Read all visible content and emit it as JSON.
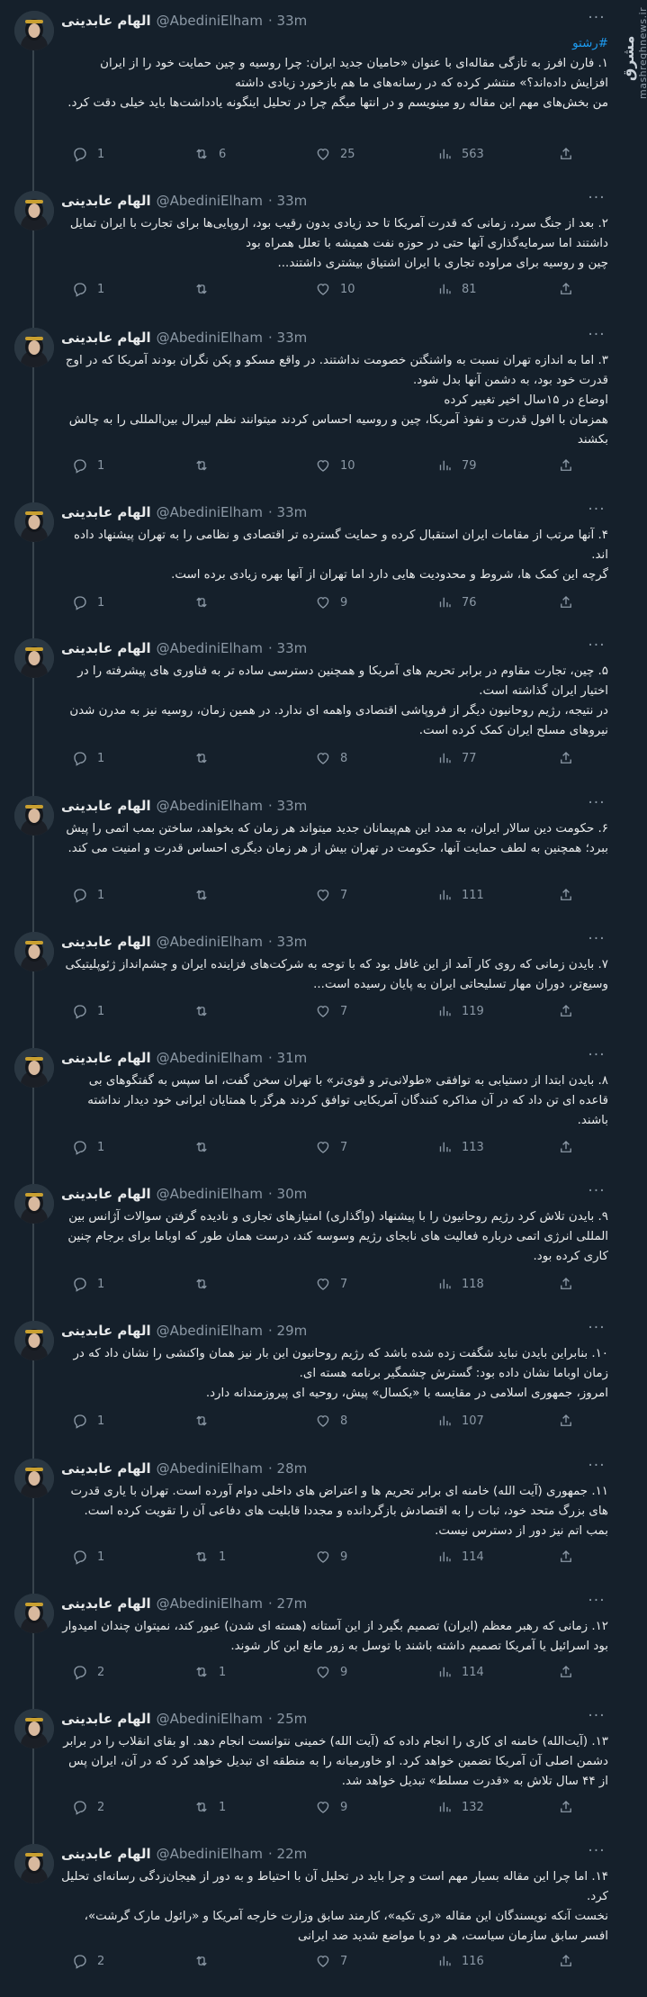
{
  "author": {
    "name": "الهام عابدینی",
    "handle": "@AbediniElham"
  },
  "brand": {
    "logo": "مشرق",
    "url": "mashreghnews.ir"
  },
  "icons": {
    "reply": "reply-icon",
    "retweet": "retweet-icon",
    "like": "heart-icon",
    "views": "views-icon",
    "share": "share-icon",
    "more": "more-icon"
  },
  "colors": {
    "background": "#15202b",
    "text": "#e7e9ea",
    "muted": "#8b98a5",
    "link": "#1d9bf0",
    "thread_line": "#38444d"
  },
  "tweets": [
    {
      "time": "· 33m",
      "hashtag": "#رشتو",
      "text": "۱. فارن افرز به تازگی مقاله‌ای با عنوان «حامیان جدید ایران: چرا روسیه و چین حمایت خود را از ایران افزایش داده‌اند؟» منتشر کرده که در رسانه‌های ما هم بازخورد زیادی داشته\nمن بخش‌های مهم این مقاله رو مینویسم و در انتها میگم چرا در تحلیل اینگونه یادداشت‌ها باید خیلی دقت کرد.",
      "reply": "1",
      "retweet": "6",
      "like": "25",
      "views": "563"
    },
    {
      "time": "· 33m",
      "hashtag": "",
      "text": "۲. بعد از جنگ سرد، زمانی که قدرت آمریکا تا حد زیادی بدون رقیب بود، اروپایی‌ها برای تجارت با ایران تمایل داشتند اما سرمایه‌گذاری آنها حتی در حوزه نفت همیشه با تعلل همراه بود\nچین و روسیه برای مراوده تجاری با ایران اشتیاق بیشتری داشتند...",
      "reply": "1",
      "retweet": "",
      "like": "10",
      "views": "81"
    },
    {
      "time": "· 33m",
      "hashtag": "",
      "text": "۳. اما به اندازه تهران نسبت به واشنگتن خصومت نداشتند. در واقع مسکو و پکن نگران بودند آمریکا که در اوج قدرت خود بود، به دشمن آنها بدل شود.\nاوضاع در ۱۵سال اخیر تغییر کرده\nهمزمان با افول قدرت و نفوذ آمریکا، چین و روسیه احساس کردند میتوانند نظم لیبرال بین‌المللی را به چالش بکشند",
      "reply": "1",
      "retweet": "",
      "like": "10",
      "views": "79"
    },
    {
      "time": "· 33m",
      "hashtag": "",
      "text": "۴. آنها مرتب از مقامات ایران استقبال کرده و حمایت گسترده تر اقتصادی و نظامی را به تهران پیشنهاد داده اند.\nگرچه این کمک ها، شروط و محدودیت هایی دارد اما تهران از آنها بهره زیادی برده است.",
      "reply": "1",
      "retweet": "",
      "like": "9",
      "views": "76"
    },
    {
      "time": "· 33m",
      "hashtag": "",
      "text": "۵. چین، تجارت مقاوم در برابر تحریم های آمریکا و همچنین دسترسی ساده تر به فناوری های پیشرفته را در اختیار ایران گذاشته است.\nدر نتیجه، رژیم روحانیون دیگر از فروپاشی اقتصادی واهمه ای ندارد. در همین زمان، روسیه نیز به مدرن شدن نیروهای مسلح ایران کمک کرده است.",
      "reply": "1",
      "retweet": "",
      "like": "8",
      "views": "77"
    },
    {
      "time": "· 33m",
      "hashtag": "",
      "text": "۶. حکومت دین سالار ایران، به مدد این هم‌پیمانان جدید میتواند هر زمان که بخواهد، ساختن بمب اتمی را پیش ببرد؛ همچنین به لطف حمایت آنها، حکومت در تهران بیش از هر زمان دیگری احساس قدرت و امنیت می کند.",
      "reply": "1",
      "retweet": "",
      "like": "7",
      "views": "111"
    },
    {
      "time": "· 33m",
      "hashtag": "",
      "text": "۷. بایدن زمانی که روی کار آمد از این غافل بود که با توجه به شرکت‌های فزاینده ایران و چشم‌انداز ژئوپلیتیکی وسیع‌تر، دوران مهار تسلیحاتی ایران به پایان رسیده است...",
      "reply": "1",
      "retweet": "",
      "like": "7",
      "views": "119"
    },
    {
      "time": "· 31m",
      "hashtag": "",
      "text": "۸. بایدن ابتدا از دستیابی به توافقی «طولانی‌تر و قوی‌تر» با تهران سخن گفت، اما سپس به گفتگوهای بی قاعده ای تن داد که در آن مذاکره کنندگان آمریکایی توافق کردند هرگز با همتایان ایرانی خود دیدار نداشته باشند.",
      "reply": "1",
      "retweet": "",
      "like": "7",
      "views": "113"
    },
    {
      "time": "· 30m",
      "hashtag": "",
      "text": "۹. بایدن تلاش کرد رژیم روحانیون را با پیشنهاد (واگذاری) امتیازهای تجاری و نادیده گرفتن سوالات آژانس بین المللی انرژی اتمی درباره فعالیت های نابجای رژیم وسوسه کند، درست همان طور که اوباما برای برجام چنین کاری کرده بود.",
      "reply": "1",
      "retweet": "",
      "like": "7",
      "views": "118"
    },
    {
      "time": "· 29m",
      "hashtag": "",
      "text": "۱۰. بنابراین بایدن نباید شگفت زده شده باشد که رژیم روحانیون این بار نیز همان واکنشی را نشان داد که در زمان اوباما نشان داده بود: گسترش چشمگیر برنامه هسته ای.\nامروز، جمهوری اسلامی در مقایسه با «یکسال» پیش، روحیه ای پیروزمندانه دارد.",
      "reply": "1",
      "retweet": "",
      "like": "8",
      "views": "107"
    },
    {
      "time": "· 28m",
      "hashtag": "",
      "text": "۱۱. جمهوری (آیت الله) خامنه ای برابر تحریم ها و اعتراض های داخلی دوام آورده است. تهران با یاری قدرت های بزرگ متحد خود، ثبات را به اقتصادش بازگردانده و مجددا قابلیت های دفاعی آن را تقویت کرده است. بمب اتم نیز دور از دسترس نیست.",
      "reply": "1",
      "retweet": "1",
      "like": "9",
      "views": "114"
    },
    {
      "time": "· 27m",
      "hashtag": "",
      "text": "۱۲. زمانی که رهبر معظم (ایران) تصمیم بگیرد از این آستانه (هسته ای شدن) عبور کند، نمیتوان چندان امیدوار بود اسرائیل یا آمریکا تصمیم داشته باشند با توسل به زور مانع این کار شوند.",
      "reply": "2",
      "retweet": "1",
      "like": "9",
      "views": "114"
    },
    {
      "time": "· 25m",
      "hashtag": "",
      "text": "۱۳. (آیت‌الله) خامنه ای کاری را انجام داده که (آیت الله) خمینی نتوانست انجام دهد. او بقای انقلاب را در برابر دشمن اصلی آن آمریکا تضمین خواهد کرد. او خاورمیانه را به منطقه ای تبدیل خواهد کرد که در آن، ایران پس از ۴۴ سال تلاش به «قدرت مسلط» تبدیل خواهد شد.",
      "reply": "2",
      "retweet": "1",
      "like": "9",
      "views": "132"
    },
    {
      "time": "· 22m",
      "hashtag": "",
      "text": "۱۴. اما چرا این مقاله بسیار مهم است و چرا باید در تحلیل آن با احتیاط و به دور از هیجان‌زدگی رسانه‌ای تحلیل کرد.\nنخست آنکه نویسندگان این مقاله «ری تکیه»، کارمند سابق وزارت خارجه آمریکا و «رائول مارک گرشت»، افسر سابق سازمان سیاست، هر دو با مواضع شدید ضد ایرانی",
      "reply": "2",
      "retweet": "",
      "like": "7",
      "views": "116"
    }
  ]
}
